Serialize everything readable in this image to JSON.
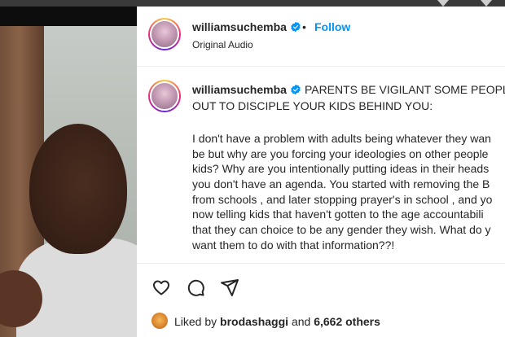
{
  "header": {
    "username": "williamsuchemba",
    "separator": "•",
    "follow_label": "Follow",
    "audio_label": "Original Audio"
  },
  "caption": {
    "username": "williamsuchemba",
    "headline_line1": "PARENTS BE VIGILANT SOME PEOPLE A",
    "headline_line2": "OUT TO DISCIPLE YOUR KIDS BEHIND YOU:",
    "body_lines": [
      "I don't have a problem with adults being whatever they wan",
      "be but why are you forcing your ideologies on other people",
      "kids? Why are you intentionally putting ideas in their heads",
      "you don't have an agenda. You started with removing the B",
      "from schools , and later stopping prayer's in school , and yo",
      "now telling kids that haven't gotten to the age accountabili",
      "that they can choice to be any gender they wish. What do y",
      "want them to do with that information??!"
    ]
  },
  "actions": {
    "like_icon": "heart-icon",
    "comment_icon": "comment-icon",
    "share_icon": "share-icon"
  },
  "likes": {
    "prefix": "Liked by",
    "user": "brodashaggi",
    "connector": "and",
    "count": "6,662 others"
  },
  "colors": {
    "accent": "#0095f6",
    "verified": "#0095f6",
    "text": "#262626"
  }
}
